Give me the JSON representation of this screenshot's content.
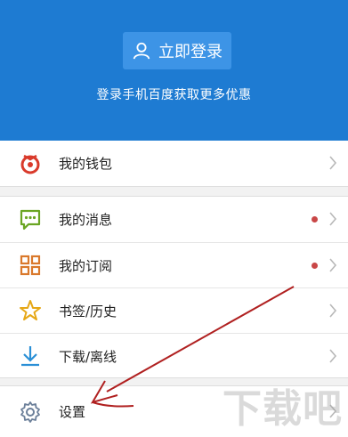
{
  "header": {
    "login_label": "立即登录",
    "subtitle": "登录手机百度获取更多优惠",
    "bg_color": "#1e7bd2"
  },
  "menu": {
    "wallet": {
      "label": "我的钱包",
      "icon": "wallet-icon"
    },
    "messages": {
      "label": "我的消息",
      "icon": "chat-bubble-icon",
      "has_dot": true
    },
    "subscriptions": {
      "label": "我的订阅",
      "icon": "grid-icon",
      "has_dot": true
    },
    "bookmarks": {
      "label": "书签/历史",
      "icon": "star-icon"
    },
    "downloads": {
      "label": "下载/离线",
      "icon": "download-icon"
    },
    "settings": {
      "label": "设置",
      "icon": "gear-icon"
    }
  },
  "annotation": {
    "color": "#b02020"
  },
  "watermark": "下载吧"
}
